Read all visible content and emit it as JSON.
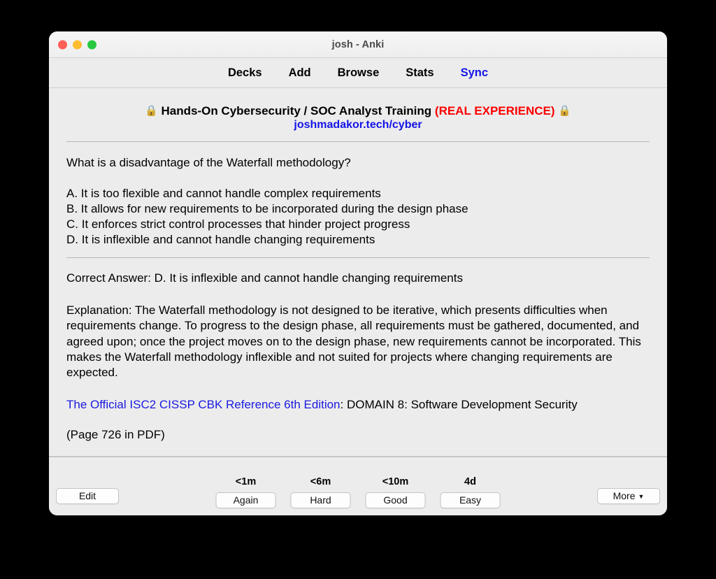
{
  "window": {
    "title": "josh - Anki",
    "traffic_lights": [
      {
        "name": "close",
        "color": "#ff5f57"
      },
      {
        "name": "minimize",
        "color": "#febc2e"
      },
      {
        "name": "zoom",
        "color": "#28c840"
      }
    ]
  },
  "nav": {
    "items": [
      {
        "label": "Decks",
        "accent": false
      },
      {
        "label": "Add",
        "accent": false
      },
      {
        "label": "Browse",
        "accent": false
      },
      {
        "label": "Stats",
        "accent": false
      },
      {
        "label": "Sync",
        "accent": true
      }
    ],
    "accent_color": "#1414e8"
  },
  "card": {
    "deck_header": {
      "lock_left_icon": "lock-icon",
      "title_main": "Hands-On Cybersecurity / SOC Analyst Training",
      "title_highlight": "(REAL EXPERIENCE)",
      "highlight_color": "#fc0000",
      "lock_right_icon": "lock-icon",
      "link": "joshmadakor.tech/cyber",
      "link_color": "#1414e8"
    },
    "question": "What is a disadvantage of the Waterfall methodology?",
    "options": [
      "A. It is too flexible and cannot handle complex requirements",
      "B. It allows for new requirements to be incorporated during the design phase",
      "C. It enforces strict control processes that hinder project progress",
      "D. It is inflexible and cannot handle changing requirements"
    ],
    "correct_answer": "Correct Answer: D. It is inflexible and cannot handle changing requirements",
    "explanation": "Explanation: The Waterfall methodology is not designed to be iterative, which presents difficulties when requirements change. To progress to the design phase, all requirements must be gathered, documented, and agreed upon; once the project moves on to the design phase, new requirements cannot be incorporated. This makes the Waterfall methodology inflexible and not suited for projects where changing requirements are expected.",
    "reference": {
      "link_text": "The Official ISC2 CISSP CBK Reference 6th Edition",
      "rest_text": ": DOMAIN 8: Software Development Security",
      "link_color": "#1a1ae2"
    },
    "page_note": "(Page 726 in PDF)"
  },
  "toolbar": {
    "edit_label": "Edit",
    "more_label": "More",
    "more_caret": "▼",
    "ease_buttons": [
      {
        "interval": "<1m",
        "label": "Again"
      },
      {
        "interval": "<6m",
        "label": "Hard"
      },
      {
        "interval": "<10m",
        "label": "Good"
      },
      {
        "interval": "4d",
        "label": "Easy"
      }
    ]
  }
}
